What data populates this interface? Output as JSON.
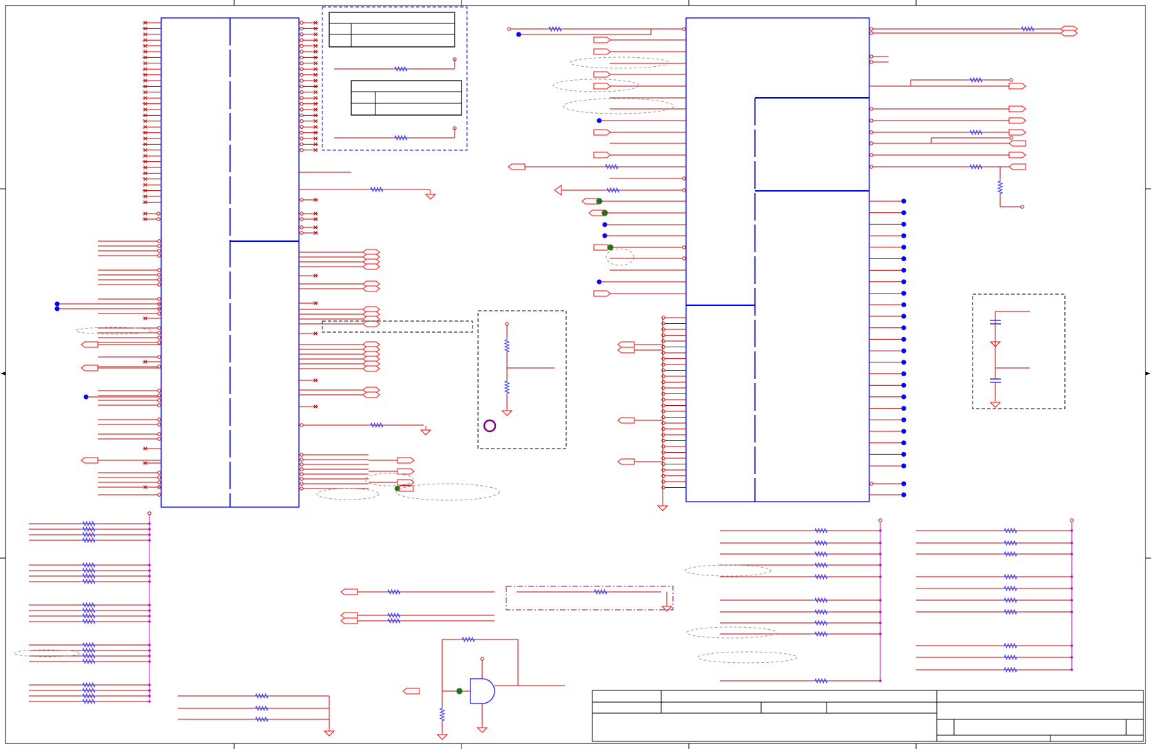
{
  "sheet": {
    "colors": {
      "wire": "#c00000",
      "component": "#0000ff",
      "resistor": "#3333ff",
      "junction": "#0000ff",
      "testpoint": "#1a7a1a",
      "power_rail": "#cc00cc",
      "note_ellipse": "#999999",
      "frame": "#000000",
      "net_port": "#ff0000"
    }
  },
  "title_block": {
    "fields": [
      "",
      "",
      "",
      "",
      "",
      "",
      "",
      "",
      ""
    ]
  }
}
